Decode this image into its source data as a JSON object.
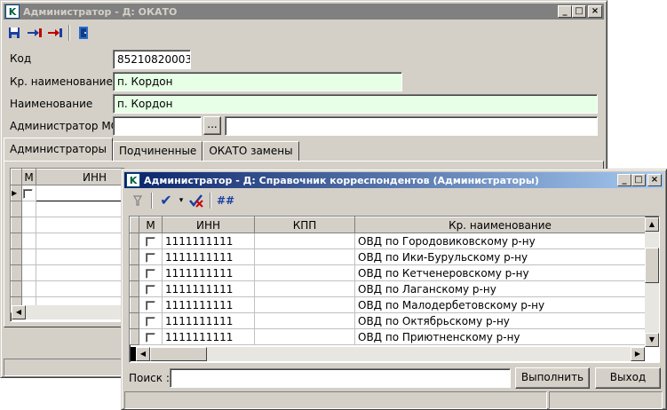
{
  "back_window": {
    "title": "Администратор - Д: ОКАТО",
    "window_buttons": {
      "minimize": "_",
      "maximize": "□",
      "close": "×"
    },
    "toolbar": [
      {
        "icon": "save-icon",
        "glyph": "💾"
      },
      {
        "icon": "add-link-icon",
        "glyph": "⇥"
      },
      {
        "icon": "remove-link-icon",
        "glyph": "⇥"
      },
      {
        "icon": "exit-door-icon",
        "glyph": "🚪"
      }
    ],
    "form": {
      "code_label": "Код",
      "code_value": "85210820003",
      "short_name_label": "Кр. наименование",
      "short_name_value": "п. Кордон",
      "name_label": "Наименование",
      "name_value": "п. Кордон",
      "admin_mo_label": "Администратор МО",
      "admin_mo_value": "",
      "admin_mo_text": "",
      "browse_label": "..."
    },
    "tabs": [
      "Администраторы",
      "Подчиненные",
      "ОКАТО замены"
    ],
    "grid": {
      "columns": [
        "М",
        "ИНН"
      ],
      "rows": [
        {
          "indicator": "▶",
          "checked": false,
          "inn": ""
        }
      ]
    }
  },
  "front_window": {
    "title": "Администратор - Д: Справочник корреспондентов (Администраторы)",
    "window_buttons": {
      "minimize": "_",
      "maximize": "□",
      "close": "×"
    },
    "toolbar": [
      {
        "icon": "filter-icon",
        "glyph": "⚲"
      },
      {
        "icon": "check-icon",
        "glyph": "✔"
      },
      {
        "icon": "dropdown-arrow-icon",
        "glyph": "▾"
      },
      {
        "icon": "uncheck-icon",
        "glyph": "✘"
      },
      {
        "icon": "number-icon",
        "glyph": "##"
      }
    ],
    "grid": {
      "columns": [
        "М",
        "ИНН",
        "КПП",
        "Кр. наименование"
      ],
      "rows": [
        {
          "checked": false,
          "inn": "1111111111",
          "kpp": "",
          "name": "ОВД по Городовиковскому р-ну"
        },
        {
          "checked": false,
          "inn": "1111111111",
          "kpp": "",
          "name": "ОВД по Ики-Бурульскому р-ну"
        },
        {
          "checked": false,
          "inn": "1111111111",
          "kpp": "",
          "name": "ОВД по Кетченеровскому р-ну"
        },
        {
          "checked": false,
          "inn": "1111111111",
          "kpp": "",
          "name": "ОВД по Лаганскому р-ну"
        },
        {
          "checked": false,
          "inn": "1111111111",
          "kpp": "",
          "name": "ОВД по Малодербетовскому р-ну"
        },
        {
          "checked": false,
          "inn": "1111111111",
          "kpp": "",
          "name": "ОВД по Октябрьскому р-ну"
        },
        {
          "checked": false,
          "inn": "1111111111",
          "kpp": "",
          "name": "ОВД по Приютненскому р-ну"
        }
      ]
    },
    "search_label": "Поиск :",
    "search_value": "",
    "execute_button": "Выполнить",
    "exit_button": "Выход",
    "scroll": {
      "up": "▲",
      "down": "▼",
      "left": "◀",
      "right": "▶"
    }
  }
}
